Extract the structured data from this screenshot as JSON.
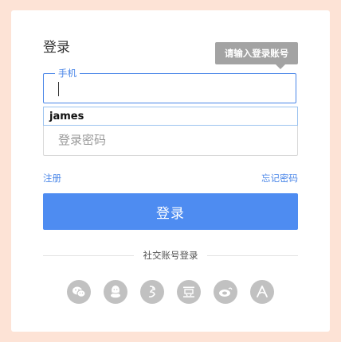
{
  "login": {
    "title": "登录",
    "tooltip": "请输入登录账号",
    "phone_label": "手机",
    "phone_value": "",
    "autocomplete_suggestion": "james",
    "password_placeholder": "登录密码",
    "register_link": "注册",
    "forgot_link": "忘记密码",
    "submit_label": "登录",
    "social_divider": "社交账号登录"
  },
  "social_icons": [
    "wechat-icon",
    "qq-icon",
    "weibo-icon",
    "douban-icon",
    "baidu-icon",
    "tieba-icon"
  ],
  "colors": {
    "page_bg": "#fde3d6",
    "accent": "#4e8cf1",
    "link": "#4a86e8",
    "icon_bg": "#c1c1c1"
  }
}
